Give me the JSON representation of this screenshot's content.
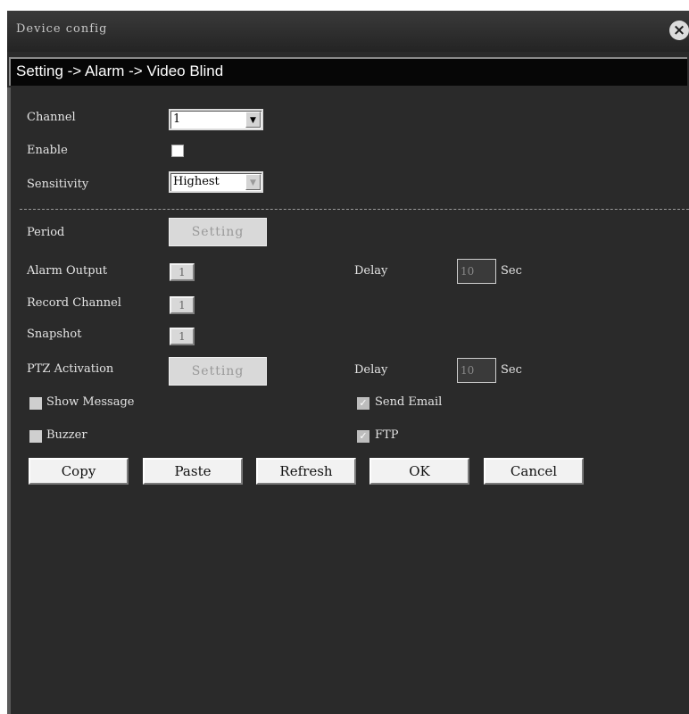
{
  "window": {
    "title": "Device config"
  },
  "breadcrumb": "Setting -> Alarm -> Video Blind",
  "channel": {
    "label": "Channel",
    "value": "1"
  },
  "enable": {
    "label": "Enable",
    "checked": false
  },
  "sensitivity": {
    "label": "Sensitivity",
    "value": "Highest"
  },
  "period": {
    "label": "Period",
    "button": "Setting"
  },
  "alarm_output": {
    "label": "Alarm Output",
    "value": "1"
  },
  "delay1": {
    "label": "Delay",
    "value": "10",
    "unit": "Sec"
  },
  "record_channel": {
    "label": "Record Channel",
    "value": "1"
  },
  "snapshot": {
    "label": "Snapshot",
    "value": "1"
  },
  "ptz": {
    "label": "PTZ Activation",
    "button": "Setting"
  },
  "delay2": {
    "label": "Delay",
    "value": "10",
    "unit": "Sec"
  },
  "show_message": {
    "label": "Show Message",
    "checked": false
  },
  "send_email": {
    "label": "Send Email",
    "checked": true
  },
  "buzzer": {
    "label": "Buzzer",
    "checked": false
  },
  "ftp": {
    "label": "FTP",
    "checked": true
  },
  "buttons": {
    "copy": "Copy",
    "paste": "Paste",
    "refresh": "Refresh",
    "ok": "OK",
    "cancel": "Cancel"
  },
  "icons": {
    "close": "close-icon",
    "dropdown": "chevron-down-icon",
    "check": "checkmark-icon"
  },
  "check_glyph": "✓"
}
